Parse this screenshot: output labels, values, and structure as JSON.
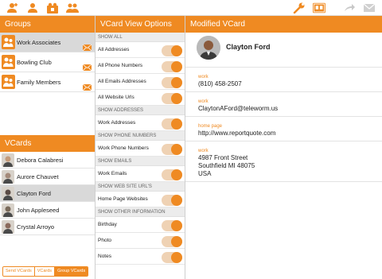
{
  "toolbar": {
    "left_icons": [
      "add-contact-icon",
      "contact-icon",
      "group-contacts-icon",
      "group-icon"
    ],
    "right_icons": [
      "wrench-icon",
      "vcard-icon",
      "forward-icon",
      "mail-icon"
    ]
  },
  "groups": {
    "header": "Groups",
    "items": [
      {
        "label": "Work Associates",
        "selected": true
      },
      {
        "label": "Bowling Club",
        "selected": false
      },
      {
        "label": "Family Members",
        "selected": false
      }
    ]
  },
  "vcards": {
    "header": "VCards",
    "items": [
      {
        "name": "Debora Calabresi",
        "selected": false
      },
      {
        "name": "Aurore Chauvet",
        "selected": false
      },
      {
        "name": "Clayton Ford",
        "selected": true
      },
      {
        "name": "John Appleseed",
        "selected": false
      },
      {
        "name": "Crystal Arroyo",
        "selected": false
      }
    ],
    "segments": [
      "Send VCards",
      "VCards",
      "Group VCards"
    ],
    "active_segment": "Group VCards"
  },
  "options": {
    "header": "VCard View Options",
    "sections": [
      {
        "title": "SHOW ALL",
        "rows": [
          "All Addresses",
          "All Phone Numbers",
          "All Emails Addresses",
          "All Website Urls"
        ]
      },
      {
        "title": "SHOW ADDRESSES",
        "rows": [
          "Work Addresses"
        ]
      },
      {
        "title": "SHOW PHONE NUMBERS",
        "rows": [
          "Work Phone Numbers"
        ]
      },
      {
        "title": "SHOW EMAILS",
        "rows": [
          "Work Emails"
        ]
      },
      {
        "title": "SHOW WEB SITE URL'S",
        "rows": [
          "Home Page Websites"
        ]
      },
      {
        "title": "SHOW OTHER INFORMATION",
        "rows": [
          "Birthday",
          "Photo",
          "Notes"
        ]
      }
    ]
  },
  "vcard": {
    "header": "Modified VCard",
    "name": "Clayton Ford",
    "fields": [
      {
        "label": "work",
        "value": "(810) 458-2507"
      },
      {
        "label": "work",
        "value": "ClaytonAFord@teleworm.us"
      },
      {
        "label": "home page",
        "value": "http://www.reportquote.com"
      },
      {
        "label": "work",
        "value": "4987 Front Street\nSouthfield MI 48075\nUSA"
      }
    ]
  },
  "colors": {
    "accent": "#ef8a22",
    "selected_row": "#d9d9d9"
  }
}
